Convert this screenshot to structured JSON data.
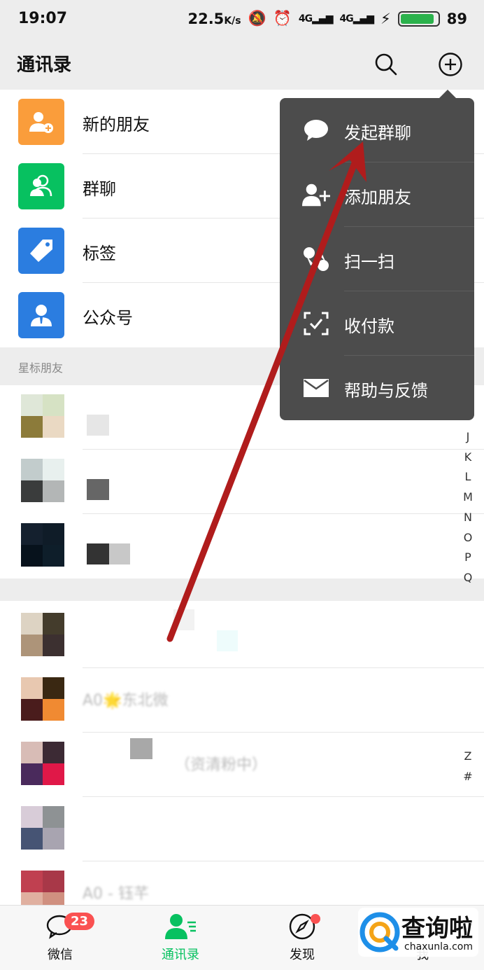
{
  "status": {
    "time": "19:07",
    "speed": "22.5",
    "speed_unit": "K/s",
    "signal1": "4G",
    "signal2": "4G",
    "battery": "89"
  },
  "header": {
    "title": "通讯录"
  },
  "fixed_items": [
    {
      "label": "新的朋友",
      "color": "#fa9d3b",
      "icon": "add-friend-icon"
    },
    {
      "label": "群聊",
      "color": "#07c160",
      "icon": "group-icon"
    },
    {
      "label": "标签",
      "color": "#2b7de0",
      "icon": "tag-icon"
    },
    {
      "label": "公众号",
      "color": "#2b7de0",
      "icon": "official-account-icon"
    }
  ],
  "starred_header": "星标朋友",
  "blurred_contacts": {
    "c5": "A0🌟东北微",
    "c6": "（资清粉中）",
    "c8": "A0 - 钰芊"
  },
  "index_letters": [
    "J",
    "K",
    "L",
    "M",
    "N",
    "O",
    "P",
    "Q"
  ],
  "index_letters_bottom": [
    "Z",
    "#"
  ],
  "popup_menu": [
    {
      "label": "发起群聊",
      "icon": "chat-bubble-icon"
    },
    {
      "label": "添加朋友",
      "icon": "add-friend-icon"
    },
    {
      "label": "扫一扫",
      "icon": "scan-icon"
    },
    {
      "label": "收付款",
      "icon": "payment-icon"
    },
    {
      "label": "帮助与反馈",
      "icon": "mail-icon"
    }
  ],
  "tabs": [
    {
      "label": "微信",
      "badge": "23"
    },
    {
      "label": "通讯录"
    },
    {
      "label": "发现"
    },
    {
      "label": "我"
    }
  ],
  "watermark": {
    "brand": "查询啦",
    "url": "chaxunla.com"
  },
  "colors": {
    "accent": "#07c160",
    "badge": "#fa5151",
    "popup_bg": "#4c4c4c",
    "arrow": "#b01c1c"
  }
}
